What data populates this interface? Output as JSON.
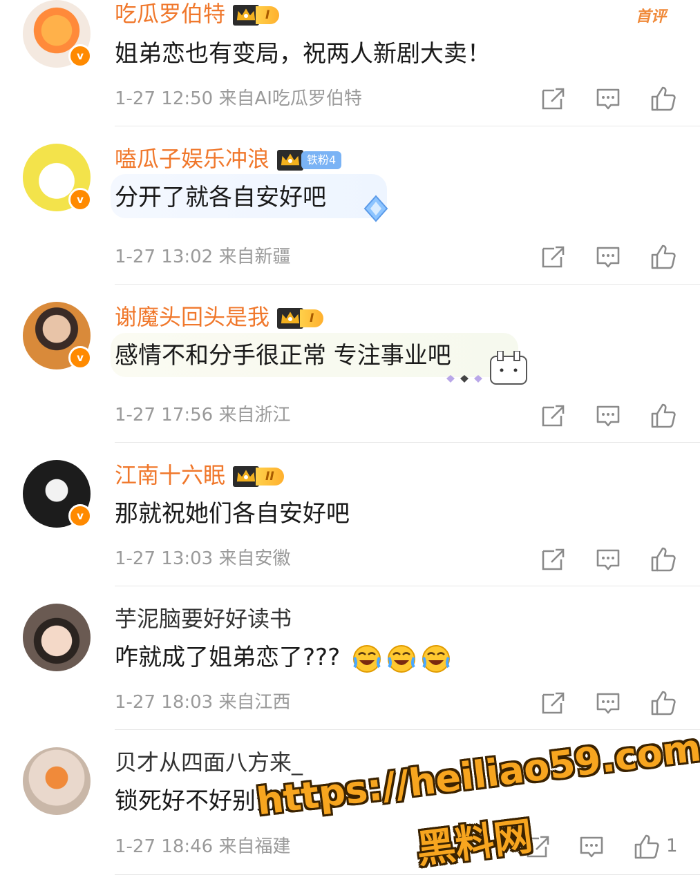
{
  "first_tag": "首评",
  "comments": [
    {
      "name": "吃瓜罗伯特",
      "level": "I",
      "text": "姐弟恋也有变局，祝两人新剧大卖！",
      "meta": "1-27 12:50  来自AI吃瓜罗伯特",
      "verified": "v"
    },
    {
      "name": "嗑瓜子娱乐冲浪",
      "fan_badge": "铁粉4",
      "text": "分开了就各自安好吧",
      "meta": "1-27 13:02  来自新疆",
      "verified": "v"
    },
    {
      "name": "谢魔头回头是我",
      "level": "I",
      "text": "感情不和分手很正常 专注事业吧",
      "meta": "1-27 17:56  来自浙江",
      "verified": "v"
    },
    {
      "name": "江南十六眠",
      "level": "II",
      "text": "那就祝她们各自安好吧",
      "meta": "1-27 13:03  来自安徽",
      "verified": "v"
    },
    {
      "name": "芋泥脑要好好读书",
      "text": "咋就成了姐弟恋了???",
      "meta": "1-27 18:03  来自江西"
    },
    {
      "name": "贝才从四面八方来_",
      "text": "锁死好不好别分了",
      "meta": "1-27 18:46  来自福建",
      "like_count": "1"
    }
  ],
  "watermark": {
    "url": "https://heiliao59.com",
    "site": "黑料网"
  },
  "icons": {
    "repost": "repost-icon",
    "comment": "comment-icon",
    "like": "like-icon"
  },
  "colors": {
    "vip_name": "#f0782c",
    "meta": "#9a9a9a",
    "badge_orange": "#ff8a00",
    "watermark": "#f7a51f"
  }
}
